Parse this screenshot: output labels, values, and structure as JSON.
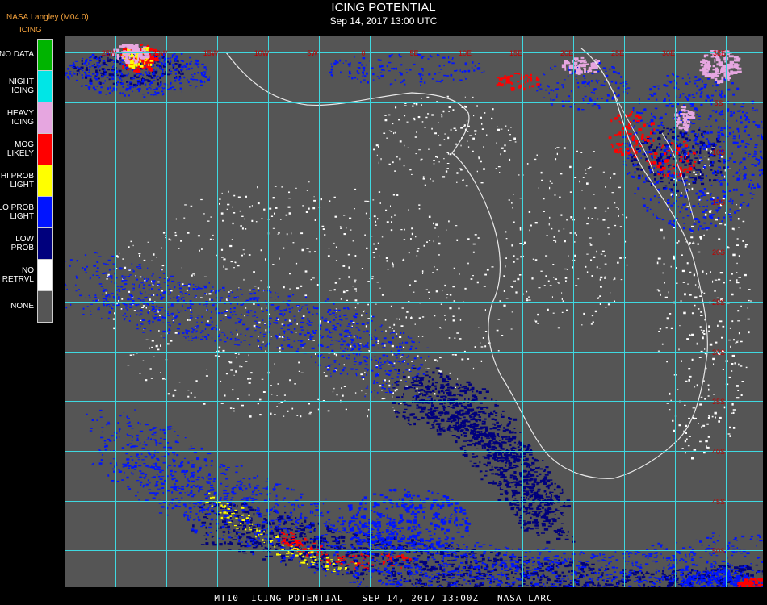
{
  "header": {
    "provider": "NASA Langley (M04.0)",
    "legend_title": "ICING",
    "title": "ICING POTENTIAL",
    "subtitle": "Sep 14, 2017 13:00 UTC"
  },
  "legend": {
    "items": [
      {
        "lines": [
          "NO DATA"
        ],
        "color": "#00b400"
      },
      {
        "lines": [
          "NIGHT",
          "ICING"
        ],
        "color": "#00e6e6"
      },
      {
        "lines": [
          "HEAVY",
          "ICING"
        ],
        "color": "#e6a6e0"
      },
      {
        "lines": [
          "MOG",
          "LIKELY"
        ],
        "color": "#ff0000"
      },
      {
        "lines": [
          "HI PROB",
          "LIGHT"
        ],
        "color": "#ffff00"
      },
      {
        "lines": [
          "LO PROB",
          "LIGHT"
        ],
        "color": "#0014ff"
      },
      {
        "lines": [
          "LOW",
          "PROB"
        ],
        "color": "#00007d"
      },
      {
        "lines": [
          "NO",
          "RETRVL"
        ],
        "color": "#ffffff"
      },
      {
        "lines": [
          "NONE"
        ],
        "color": "#555555"
      }
    ]
  },
  "map": {
    "background": "#555555",
    "grid_color": "#3fd8e0",
    "coast_color": "#e8e8e8",
    "grid_label_color": "#c00000",
    "top_labels": [
      "25W",
      "20W",
      "15W",
      "10W",
      "5W",
      "0",
      "5E",
      "10E",
      "15E",
      "20E",
      "25E",
      "30E",
      "35E"
    ],
    "right_labels": [
      "5S",
      "10S",
      "15S",
      "20S",
      "25S",
      "30S",
      "35S",
      "40S",
      "45S",
      "50S"
    ]
  },
  "footer": {
    "text": "MT10  ICING POTENTIAL   SEP 14, 2017 13:00Z   NASA LARC"
  }
}
